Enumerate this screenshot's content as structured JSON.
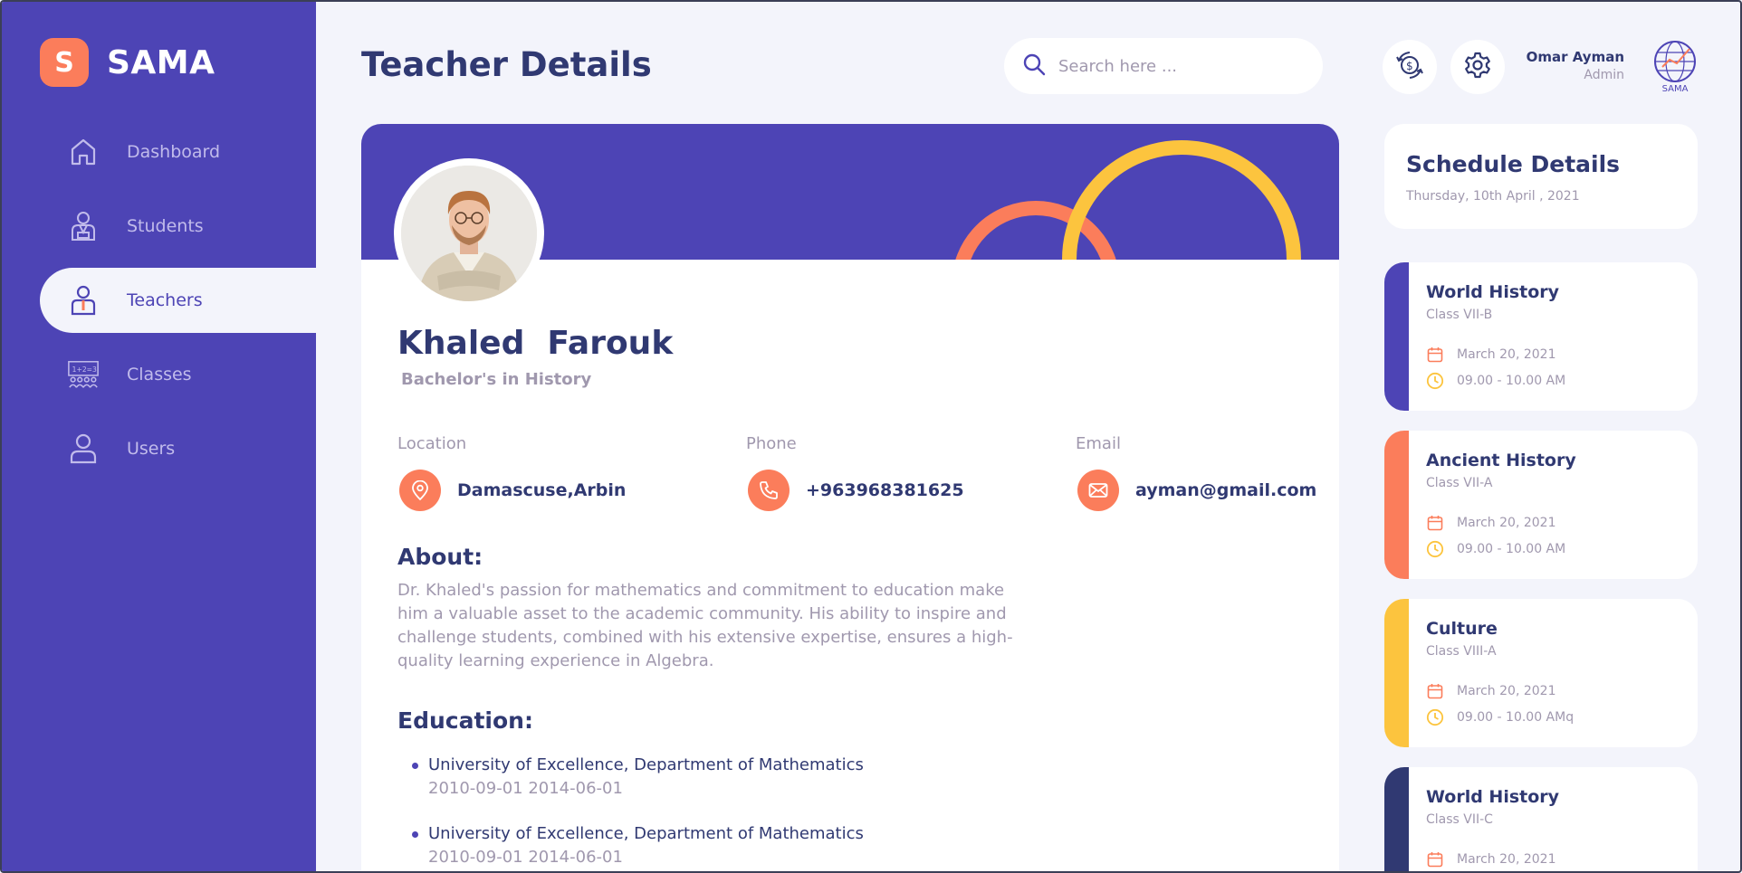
{
  "app": {
    "logo_letter": "S",
    "logo_text": "SAMA"
  },
  "sidebar": {
    "items": [
      {
        "label": "Dashboard",
        "icon": "home-icon",
        "active": false
      },
      {
        "label": "Students",
        "icon": "student-icon",
        "active": false
      },
      {
        "label": "Teachers",
        "icon": "teacher-icon",
        "active": true
      },
      {
        "label": "Classes",
        "icon": "classroom-icon",
        "active": false
      },
      {
        "label": "Users",
        "icon": "user-icon",
        "active": false
      }
    ]
  },
  "header": {
    "title": "Teacher Details",
    "search_placeholder": "Search here ...",
    "user_name": "Omar Ayman",
    "user_role": "Admin",
    "avatar_text": "SAMA"
  },
  "teacher": {
    "first_name": "Khaled",
    "last_name": "Farouk",
    "degree": "Bachelor's in History",
    "location_label": "Location",
    "location": "Damascuse,Arbin",
    "phone_label": "Phone",
    "phone": "+963968381625",
    "email_label": "Email",
    "email": "ayman@gmail.com",
    "about_title": "About:",
    "about": "Dr. Khaled's passion for mathematics and commitment to education make him a valuable asset to the academic community. His ability to inspire and challenge students, combined with his extensive expertise, ensures a high-quality learning experience in Algebra.",
    "education_title": "Education:",
    "education": [
      {
        "school": "University of Excellence, Department of Mathematics",
        "dates": "2010-09-01 2014-06-01"
      },
      {
        "school": "University of Excellence, Department of Mathematics",
        "dates": "2010-09-01 2014-06-01"
      }
    ]
  },
  "schedule": {
    "title": "Schedule Details",
    "date": "Thursday, 10th April , 2021",
    "items": [
      {
        "subject": "World History",
        "class": "Class VII-B",
        "date": "March 20, 2021",
        "time": "09.00 - 10.00 AM",
        "color": "#4d44b5"
      },
      {
        "subject": "Ancient History",
        "class": "Class VII-A",
        "date": "March 20, 2021",
        "time": "09.00 - 10.00 AM",
        "color": "#fb7d5b"
      },
      {
        "subject": "Culture",
        "class": "Class VIII-A",
        "date": "March 20, 2021",
        "time": "09.00 - 10.00 AMq",
        "color": "#fcc43e"
      },
      {
        "subject": "World History",
        "class": "Class VII-C",
        "date": "March 20, 2021",
        "time": "",
        "color": "#303972"
      }
    ]
  },
  "colors": {
    "primary": "#4d44b5",
    "orange": "#fb7d5b",
    "yellow": "#fcc43e",
    "navy": "#303972",
    "muted": "#a098ae",
    "background": "#f3f4fb"
  }
}
